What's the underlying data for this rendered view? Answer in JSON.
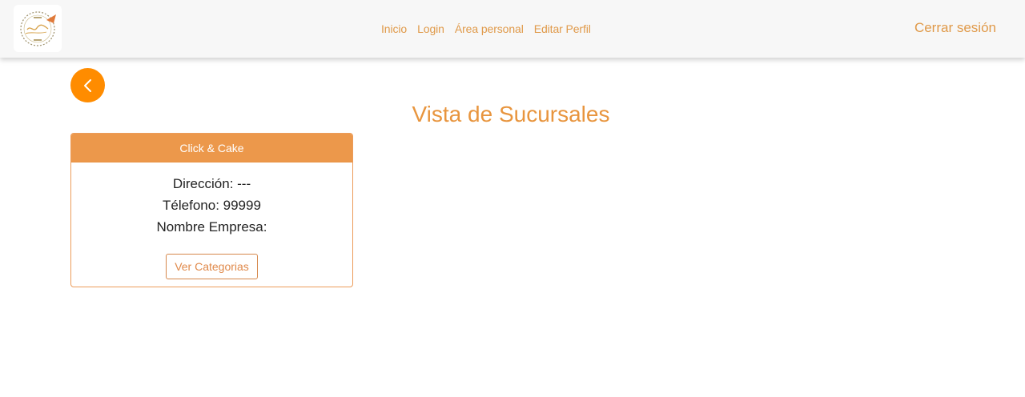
{
  "navbar": {
    "logo_icon": "click-cake-logo",
    "links": [
      "Inicio",
      "Login",
      "Área personal",
      "Editar Perfil"
    ],
    "logout_label": "Cerrar sesión"
  },
  "back_button": {
    "icon": "chevron-left-icon"
  },
  "page": {
    "title": "Vista de Sucursales"
  },
  "card": {
    "title": "Click & Cake",
    "direccion": "Dirección: ---",
    "telefono": "Télefono: 99999",
    "empresa": "Nombre Empresa:",
    "button_label": "Ver Categorias"
  },
  "colors": {
    "accent": "#e8953e",
    "back_button": "#ff8c00",
    "card_header": "#ec984b"
  }
}
